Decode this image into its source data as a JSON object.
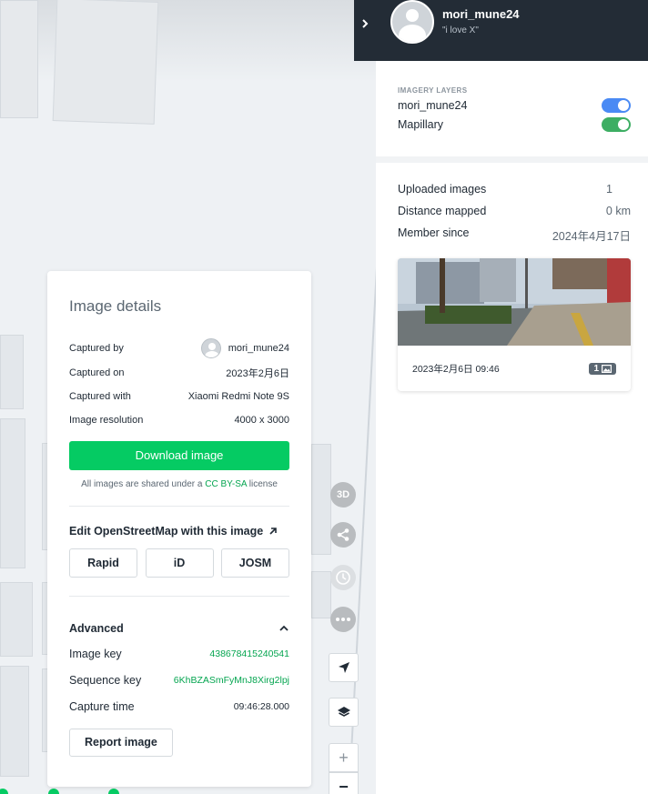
{
  "details": {
    "title": "Image details",
    "rows": [
      {
        "label": "Captured by",
        "value": "mori_mune24"
      },
      {
        "label": "Captured on",
        "value": "2023年2月6日"
      },
      {
        "label": "Captured with",
        "value": "Xiaomi Redmi Note 9S"
      },
      {
        "label": "Image resolution",
        "value": "4000 x 3000"
      }
    ],
    "download_label": "Download image",
    "license_prefix": "All images are shared under a ",
    "license_link": "CC BY-SA",
    "license_suffix": " license",
    "edit_heading": "Edit OpenStreetMap with this image",
    "edit_buttons": [
      "Rapid",
      "iD",
      "JOSM"
    ],
    "advanced_heading": "Advanced",
    "advanced_rows": [
      {
        "label": "Image key",
        "value": "438678415240541"
      },
      {
        "label": "Sequence key",
        "value": "6KhBZASmFyMnJ8Xirg2lpj"
      },
      {
        "label": "Capture time",
        "value": "09:46:28.000"
      }
    ],
    "report_label": "Report image"
  },
  "controls": {
    "three_d_label": "3D",
    "share_icon": "share-icon",
    "history_icon": "clock-icon",
    "more_icon": "more-icon",
    "locate_icon": "location-arrow-icon",
    "layers_icon": "layers-icon",
    "zoom_in": "+",
    "zoom_out": "−"
  },
  "profile": {
    "username": "mori_mune24",
    "status": "\"i love X\""
  },
  "layers": {
    "label": "IMAGERY LAYERS",
    "items": [
      {
        "name": "mori_mune24",
        "color": "#4a8af4"
      },
      {
        "name": "Mapillary",
        "color": "#3dae63"
      }
    ]
  },
  "stats": [
    {
      "label": "Uploaded images",
      "value": "1"
    },
    {
      "label": "Distance mapped",
      "value": "0 km"
    },
    {
      "label": "Member since",
      "value": "2024年4月17日"
    }
  ],
  "image_card": {
    "date": "2023年2月6日 09:46",
    "count": "1"
  }
}
